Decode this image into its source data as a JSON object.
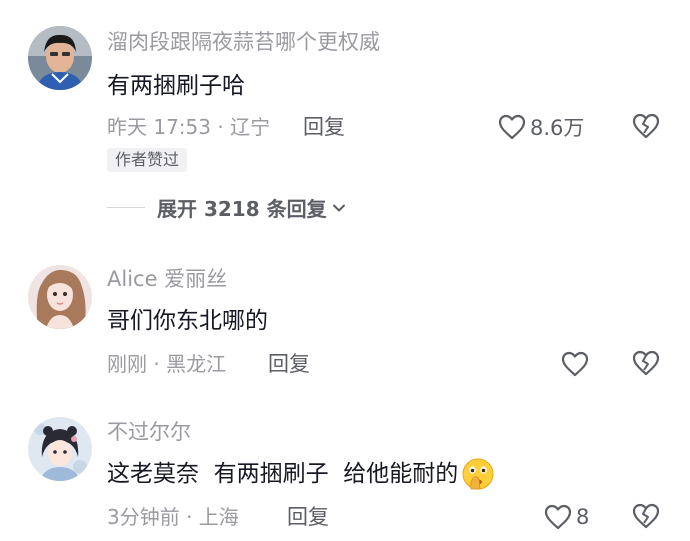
{
  "comments": [
    {
      "username": "溜肉段跟隔夜蒜苔哪个更权威",
      "text": "有两捆刷子哈",
      "time_location": "昨天 17:53 · 辽宁",
      "reply_label": "回复",
      "like_count": "8.6万",
      "badge": "作者赞过",
      "expand_label": "展开 3218 条回复"
    },
    {
      "username": "Alice 爱丽丝",
      "text": "哥们你东北哪的",
      "time_location": "刚刚 · 黑龙江",
      "reply_label": "回复",
      "like_count": ""
    },
    {
      "username": "不过尔尔",
      "text": "这老莫奈  有两捆刷子  给他能耐的",
      "emoji": "shushing-face-emoji",
      "time_location": "3分钟前 · 上海",
      "reply_label": "回复",
      "like_count": "8"
    }
  ],
  "colors": {
    "primary_text": "#161823",
    "secondary_text": "#9a9ba0",
    "action_text": "#5c5e66",
    "badge_bg": "#f1f1f3"
  }
}
